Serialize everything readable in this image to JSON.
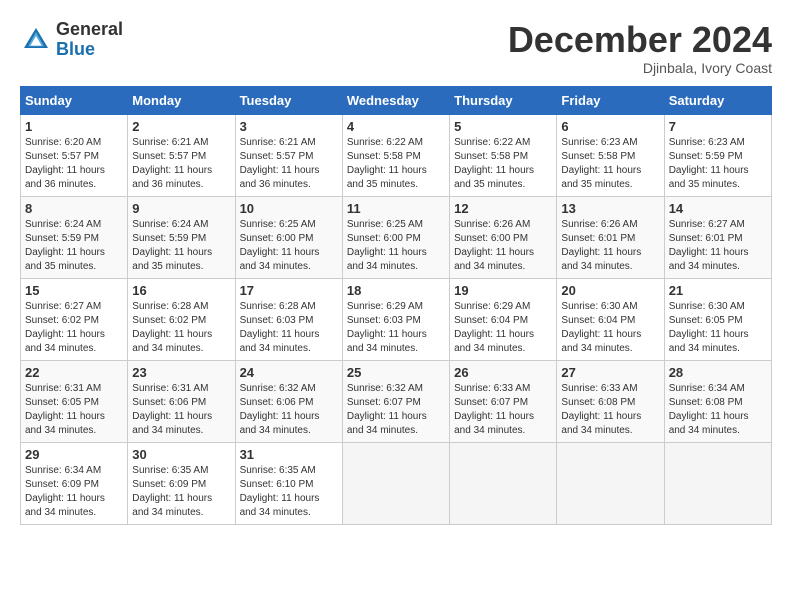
{
  "header": {
    "logo_general": "General",
    "logo_blue": "Blue",
    "month_title": "December 2024",
    "location": "Djinbala, Ivory Coast"
  },
  "weekdays": [
    "Sunday",
    "Monday",
    "Tuesday",
    "Wednesday",
    "Thursday",
    "Friday",
    "Saturday"
  ],
  "weeks": [
    [
      {
        "day": "1",
        "sunrise": "6:20 AM",
        "sunset": "5:57 PM",
        "daylight": "11 hours and 36 minutes."
      },
      {
        "day": "2",
        "sunrise": "6:21 AM",
        "sunset": "5:57 PM",
        "daylight": "11 hours and 36 minutes."
      },
      {
        "day": "3",
        "sunrise": "6:21 AM",
        "sunset": "5:57 PM",
        "daylight": "11 hours and 36 minutes."
      },
      {
        "day": "4",
        "sunrise": "6:22 AM",
        "sunset": "5:58 PM",
        "daylight": "11 hours and 35 minutes."
      },
      {
        "day": "5",
        "sunrise": "6:22 AM",
        "sunset": "5:58 PM",
        "daylight": "11 hours and 35 minutes."
      },
      {
        "day": "6",
        "sunrise": "6:23 AM",
        "sunset": "5:58 PM",
        "daylight": "11 hours and 35 minutes."
      },
      {
        "day": "7",
        "sunrise": "6:23 AM",
        "sunset": "5:59 PM",
        "daylight": "11 hours and 35 minutes."
      }
    ],
    [
      {
        "day": "8",
        "sunrise": "6:24 AM",
        "sunset": "5:59 PM",
        "daylight": "11 hours and 35 minutes."
      },
      {
        "day": "9",
        "sunrise": "6:24 AM",
        "sunset": "5:59 PM",
        "daylight": "11 hours and 35 minutes."
      },
      {
        "day": "10",
        "sunrise": "6:25 AM",
        "sunset": "6:00 PM",
        "daylight": "11 hours and 34 minutes."
      },
      {
        "day": "11",
        "sunrise": "6:25 AM",
        "sunset": "6:00 PM",
        "daylight": "11 hours and 34 minutes."
      },
      {
        "day": "12",
        "sunrise": "6:26 AM",
        "sunset": "6:00 PM",
        "daylight": "11 hours and 34 minutes."
      },
      {
        "day": "13",
        "sunrise": "6:26 AM",
        "sunset": "6:01 PM",
        "daylight": "11 hours and 34 minutes."
      },
      {
        "day": "14",
        "sunrise": "6:27 AM",
        "sunset": "6:01 PM",
        "daylight": "11 hours and 34 minutes."
      }
    ],
    [
      {
        "day": "15",
        "sunrise": "6:27 AM",
        "sunset": "6:02 PM",
        "daylight": "11 hours and 34 minutes."
      },
      {
        "day": "16",
        "sunrise": "6:28 AM",
        "sunset": "6:02 PM",
        "daylight": "11 hours and 34 minutes."
      },
      {
        "day": "17",
        "sunrise": "6:28 AM",
        "sunset": "6:03 PM",
        "daylight": "11 hours and 34 minutes."
      },
      {
        "day": "18",
        "sunrise": "6:29 AM",
        "sunset": "6:03 PM",
        "daylight": "11 hours and 34 minutes."
      },
      {
        "day": "19",
        "sunrise": "6:29 AM",
        "sunset": "6:04 PM",
        "daylight": "11 hours and 34 minutes."
      },
      {
        "day": "20",
        "sunrise": "6:30 AM",
        "sunset": "6:04 PM",
        "daylight": "11 hours and 34 minutes."
      },
      {
        "day": "21",
        "sunrise": "6:30 AM",
        "sunset": "6:05 PM",
        "daylight": "11 hours and 34 minutes."
      }
    ],
    [
      {
        "day": "22",
        "sunrise": "6:31 AM",
        "sunset": "6:05 PM",
        "daylight": "11 hours and 34 minutes."
      },
      {
        "day": "23",
        "sunrise": "6:31 AM",
        "sunset": "6:06 PM",
        "daylight": "11 hours and 34 minutes."
      },
      {
        "day": "24",
        "sunrise": "6:32 AM",
        "sunset": "6:06 PM",
        "daylight": "11 hours and 34 minutes."
      },
      {
        "day": "25",
        "sunrise": "6:32 AM",
        "sunset": "6:07 PM",
        "daylight": "11 hours and 34 minutes."
      },
      {
        "day": "26",
        "sunrise": "6:33 AM",
        "sunset": "6:07 PM",
        "daylight": "11 hours and 34 minutes."
      },
      {
        "day": "27",
        "sunrise": "6:33 AM",
        "sunset": "6:08 PM",
        "daylight": "11 hours and 34 minutes."
      },
      {
        "day": "28",
        "sunrise": "6:34 AM",
        "sunset": "6:08 PM",
        "daylight": "11 hours and 34 minutes."
      }
    ],
    [
      {
        "day": "29",
        "sunrise": "6:34 AM",
        "sunset": "6:09 PM",
        "daylight": "11 hours and 34 minutes."
      },
      {
        "day": "30",
        "sunrise": "6:35 AM",
        "sunset": "6:09 PM",
        "daylight": "11 hours and 34 minutes."
      },
      {
        "day": "31",
        "sunrise": "6:35 AM",
        "sunset": "6:10 PM",
        "daylight": "11 hours and 34 minutes."
      },
      null,
      null,
      null,
      null
    ]
  ]
}
